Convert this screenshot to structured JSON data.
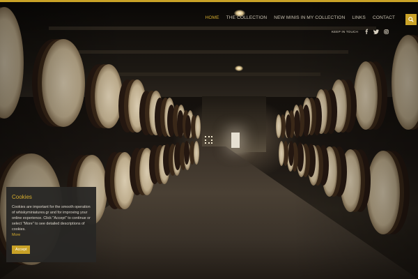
{
  "nav": {
    "items": [
      {
        "label": "HOME",
        "active": true
      },
      {
        "label": "THE COLLECTION",
        "active": false
      },
      {
        "label": "NEW MINIS IN MY COLLECTION",
        "active": false
      },
      {
        "label": "LINKS",
        "active": false
      },
      {
        "label": "CONTACT",
        "active": false
      }
    ],
    "search_icon": "search-icon"
  },
  "social": {
    "label": "KEEP IN TOUCH",
    "icons": [
      "facebook-icon",
      "twitter-icon",
      "instagram-icon"
    ]
  },
  "cookie": {
    "title": "Cookies",
    "text": "Cookies are important for the smooth operation of whiskyminiatures.gr and for improving your online experience. Click \"Accept\" to continue or select \"More\" to see detailed descriptions of cookies.",
    "more": "More",
    "accept": "Accept"
  },
  "colors": {
    "accent": "#c9a227",
    "nav_text": "#c9c2b2",
    "panel_bg": "#282624"
  }
}
